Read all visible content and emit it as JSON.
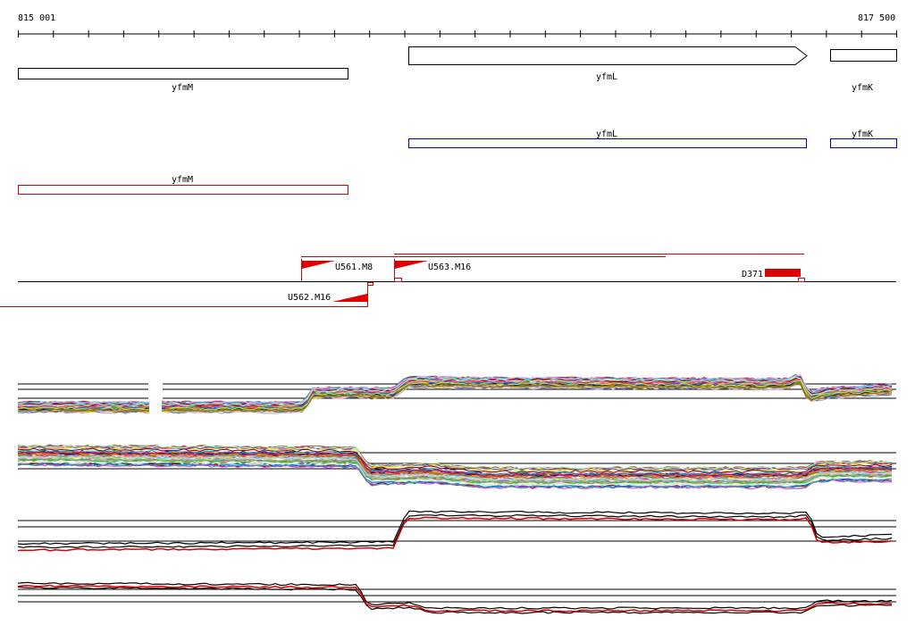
{
  "ruler": {
    "start_label": "815 001",
    "end_label": "817 500"
  },
  "genes_annotation": [
    {
      "name": "yfmM",
      "strand": "none"
    },
    {
      "name": "yfmL",
      "strand": "forward"
    },
    {
      "name": "yfmK",
      "strand": "none"
    }
  ],
  "transcripts_blue": [
    {
      "name": "yfmL"
    },
    {
      "name": "yfmK"
    }
  ],
  "transcripts_red": [
    {
      "name": "yfmM"
    }
  ],
  "features": [
    {
      "name": "U561.M8"
    },
    {
      "name": "U563.M16"
    },
    {
      "name": "U562.M16"
    },
    {
      "name": "D371"
    }
  ],
  "colors": {
    "gene_outline": "#000000",
    "blue_track": "#0000cc",
    "red_track": "#dd0000",
    "axis": "#000000"
  },
  "expression_panels": [
    {
      "id": "multi-forward",
      "style": "many-series"
    },
    {
      "id": "multi-reverse",
      "style": "many-series"
    },
    {
      "id": "pair-forward",
      "style": "black-red"
    },
    {
      "id": "pair-reverse",
      "style": "black-red"
    }
  ]
}
